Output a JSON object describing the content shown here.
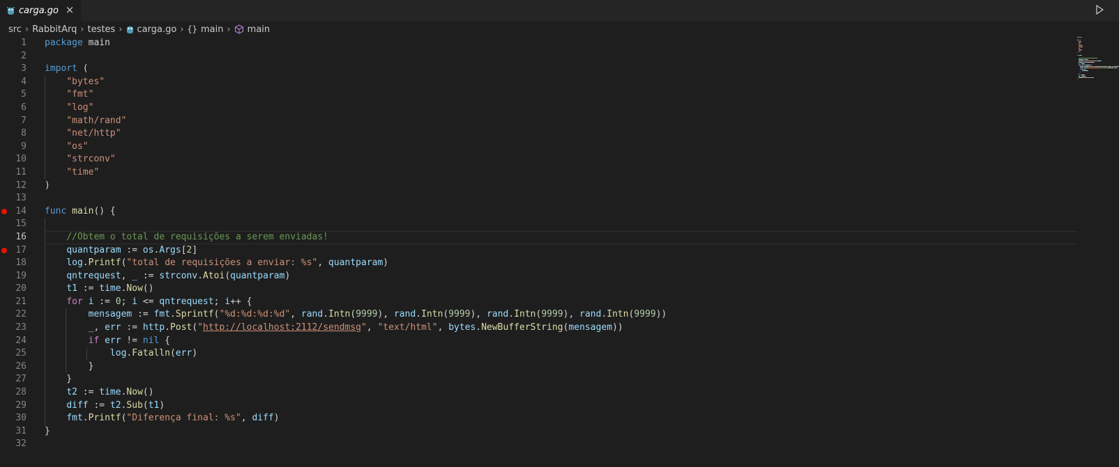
{
  "tab": {
    "label": "carga.go",
    "close": "×"
  },
  "breadcrumb": {
    "items": [
      "src",
      "RabbitArq",
      "testes",
      "carga.go",
      "main",
      "main"
    ]
  },
  "colors": {
    "breakpoint": "#e51400",
    "keyword": "#569cd6",
    "control": "#c586c0",
    "string": "#ce9178",
    "function": "#dcdcaa",
    "variable": "#9cdcfe",
    "number": "#b5cea8",
    "comment": "#6a9955",
    "go_icon": "#519aba"
  },
  "editor": {
    "current_line": 16,
    "breakpoints": [
      14,
      17
    ],
    "lines": [
      {
        "n": "1",
        "t": [
          [
            "kw",
            "package"
          ],
          [
            "pl",
            " main"
          ]
        ]
      },
      {
        "n": "2",
        "t": []
      },
      {
        "n": "3",
        "t": [
          [
            "kw",
            "import"
          ],
          [
            "pl",
            " ("
          ]
        ]
      },
      {
        "n": "4",
        "t": [
          [
            "pl",
            "    "
          ],
          [
            "str",
            "\"bytes\""
          ]
        ]
      },
      {
        "n": "5",
        "t": [
          [
            "pl",
            "    "
          ],
          [
            "str",
            "\"fmt\""
          ]
        ]
      },
      {
        "n": "6",
        "t": [
          [
            "pl",
            "    "
          ],
          [
            "str",
            "\"log\""
          ]
        ]
      },
      {
        "n": "7",
        "t": [
          [
            "pl",
            "    "
          ],
          [
            "str",
            "\"math/rand\""
          ]
        ]
      },
      {
        "n": "8",
        "t": [
          [
            "pl",
            "    "
          ],
          [
            "str",
            "\"net/http\""
          ]
        ]
      },
      {
        "n": "9",
        "t": [
          [
            "pl",
            "    "
          ],
          [
            "str",
            "\"os\""
          ]
        ]
      },
      {
        "n": "10",
        "t": [
          [
            "pl",
            "    "
          ],
          [
            "str",
            "\"strconv\""
          ]
        ]
      },
      {
        "n": "11",
        "t": [
          [
            "pl",
            "    "
          ],
          [
            "str",
            "\"time\""
          ]
        ]
      },
      {
        "n": "12",
        "t": [
          [
            "pl",
            ")"
          ]
        ]
      },
      {
        "n": "13",
        "t": []
      },
      {
        "n": "14",
        "t": [
          [
            "kw",
            "func"
          ],
          [
            "pl",
            " "
          ],
          [
            "fn",
            "main"
          ],
          [
            "pl",
            "() {"
          ]
        ]
      },
      {
        "n": "15",
        "t": []
      },
      {
        "n": "16",
        "t": [
          [
            "pl",
            "    "
          ],
          [
            "cm",
            "//Obtem o total de requisições a serem enviadas!"
          ]
        ]
      },
      {
        "n": "17",
        "t": [
          [
            "pl",
            "    "
          ],
          [
            "var",
            "quantparam"
          ],
          [
            "pl",
            " := "
          ],
          [
            "var",
            "os"
          ],
          [
            "pl",
            "."
          ],
          [
            "var",
            "Args"
          ],
          [
            "pl",
            "["
          ],
          [
            "num",
            "2"
          ],
          [
            "pl",
            "]"
          ]
        ]
      },
      {
        "n": "18",
        "t": [
          [
            "pl",
            "    "
          ],
          [
            "var",
            "log"
          ],
          [
            "pl",
            "."
          ],
          [
            "fn",
            "Printf"
          ],
          [
            "pl",
            "("
          ],
          [
            "str",
            "\"total de requisições a enviar: %s\""
          ],
          [
            "pl",
            ", "
          ],
          [
            "var",
            "quantparam"
          ],
          [
            "pl",
            ")"
          ]
        ]
      },
      {
        "n": "19",
        "t": [
          [
            "pl",
            "    "
          ],
          [
            "var",
            "qntrequest"
          ],
          [
            "pl",
            ", "
          ],
          [
            "var",
            "_"
          ],
          [
            "pl",
            " := "
          ],
          [
            "var",
            "strconv"
          ],
          [
            "pl",
            "."
          ],
          [
            "fn",
            "Atoi"
          ],
          [
            "pl",
            "("
          ],
          [
            "var",
            "quantparam"
          ],
          [
            "pl",
            ")"
          ]
        ]
      },
      {
        "n": "20",
        "t": [
          [
            "pl",
            "    "
          ],
          [
            "var",
            "t1"
          ],
          [
            "pl",
            " := "
          ],
          [
            "var",
            "time"
          ],
          [
            "pl",
            "."
          ],
          [
            "fn",
            "Now"
          ],
          [
            "pl",
            "()"
          ]
        ]
      },
      {
        "n": "21",
        "t": [
          [
            "pl",
            "    "
          ],
          [
            "kw2",
            "for"
          ],
          [
            "pl",
            " "
          ],
          [
            "var",
            "i"
          ],
          [
            "pl",
            " := "
          ],
          [
            "num",
            "0"
          ],
          [
            "pl",
            "; "
          ],
          [
            "var",
            "i"
          ],
          [
            "pl",
            " <= "
          ],
          [
            "var",
            "qntrequest"
          ],
          [
            "pl",
            "; "
          ],
          [
            "var",
            "i"
          ],
          [
            "pl",
            "++ {"
          ]
        ]
      },
      {
        "n": "22",
        "t": [
          [
            "pl",
            "        "
          ],
          [
            "var",
            "mensagem"
          ],
          [
            "pl",
            " := "
          ],
          [
            "var",
            "fmt"
          ],
          [
            "pl",
            "."
          ],
          [
            "fn",
            "Sprintf"
          ],
          [
            "pl",
            "("
          ],
          [
            "str",
            "\"%d:%d:%d:%d\""
          ],
          [
            "pl",
            ", "
          ],
          [
            "var",
            "rand"
          ],
          [
            "pl",
            "."
          ],
          [
            "fn",
            "Intn"
          ],
          [
            "pl",
            "("
          ],
          [
            "num",
            "9999"
          ],
          [
            "pl",
            "), "
          ],
          [
            "var",
            "rand"
          ],
          [
            "pl",
            "."
          ],
          [
            "fn",
            "Intn"
          ],
          [
            "pl",
            "("
          ],
          [
            "num",
            "9999"
          ],
          [
            "pl",
            "), "
          ],
          [
            "var",
            "rand"
          ],
          [
            "pl",
            "."
          ],
          [
            "fn",
            "Intn"
          ],
          [
            "pl",
            "("
          ],
          [
            "num",
            "9999"
          ],
          [
            "pl",
            "), "
          ],
          [
            "var",
            "rand"
          ],
          [
            "pl",
            "."
          ],
          [
            "fn",
            "Intn"
          ],
          [
            "pl",
            "("
          ],
          [
            "num",
            "9999"
          ],
          [
            "pl",
            "))"
          ]
        ]
      },
      {
        "n": "23",
        "t": [
          [
            "pl",
            "        "
          ],
          [
            "var",
            "_"
          ],
          [
            "pl",
            ", "
          ],
          [
            "var",
            "err"
          ],
          [
            "pl",
            " := "
          ],
          [
            "var",
            "http"
          ],
          [
            "pl",
            "."
          ],
          [
            "fn",
            "Post"
          ],
          [
            "pl",
            "("
          ],
          [
            "str",
            "\""
          ],
          [
            "url",
            "http://localhost:2112/sendmsg"
          ],
          [
            "str",
            "\""
          ],
          [
            "pl",
            ", "
          ],
          [
            "str",
            "\"text/html\""
          ],
          [
            "pl",
            ", "
          ],
          [
            "var",
            "bytes"
          ],
          [
            "pl",
            "."
          ],
          [
            "fn",
            "NewBufferString"
          ],
          [
            "pl",
            "("
          ],
          [
            "var",
            "mensagem"
          ],
          [
            "pl",
            "))"
          ]
        ]
      },
      {
        "n": "24",
        "t": [
          [
            "pl",
            "        "
          ],
          [
            "kw2",
            "if"
          ],
          [
            "pl",
            " "
          ],
          [
            "var",
            "err"
          ],
          [
            "pl",
            " != "
          ],
          [
            "kw",
            "nil"
          ],
          [
            "pl",
            " {"
          ]
        ]
      },
      {
        "n": "25",
        "t": [
          [
            "pl",
            "            "
          ],
          [
            "var",
            "log"
          ],
          [
            "pl",
            "."
          ],
          [
            "fn",
            "Fatalln"
          ],
          [
            "pl",
            "("
          ],
          [
            "var",
            "err"
          ],
          [
            "pl",
            ")"
          ]
        ]
      },
      {
        "n": "26",
        "t": [
          [
            "pl",
            "        }"
          ]
        ]
      },
      {
        "n": "27",
        "t": [
          [
            "pl",
            "    }"
          ]
        ]
      },
      {
        "n": "28",
        "t": [
          [
            "pl",
            "    "
          ],
          [
            "var",
            "t2"
          ],
          [
            "pl",
            " := "
          ],
          [
            "var",
            "time"
          ],
          [
            "pl",
            "."
          ],
          [
            "fn",
            "Now"
          ],
          [
            "pl",
            "()"
          ]
        ]
      },
      {
        "n": "29",
        "t": [
          [
            "pl",
            "    "
          ],
          [
            "var",
            "diff"
          ],
          [
            "pl",
            " := "
          ],
          [
            "var",
            "t2"
          ],
          [
            "pl",
            "."
          ],
          [
            "fn",
            "Sub"
          ],
          [
            "pl",
            "("
          ],
          [
            "var",
            "t1"
          ],
          [
            "pl",
            ")"
          ]
        ]
      },
      {
        "n": "30",
        "t": [
          [
            "pl",
            "    "
          ],
          [
            "var",
            "fmt"
          ],
          [
            "pl",
            "."
          ],
          [
            "fn",
            "Printf"
          ],
          [
            "pl",
            "("
          ],
          [
            "str",
            "\"Diferença final: %s\""
          ],
          [
            "pl",
            ", "
          ],
          [
            "var",
            "diff"
          ],
          [
            "pl",
            ")"
          ]
        ]
      },
      {
        "n": "31",
        "t": [
          [
            "pl",
            "}"
          ]
        ]
      },
      {
        "n": "32",
        "t": []
      }
    ]
  }
}
